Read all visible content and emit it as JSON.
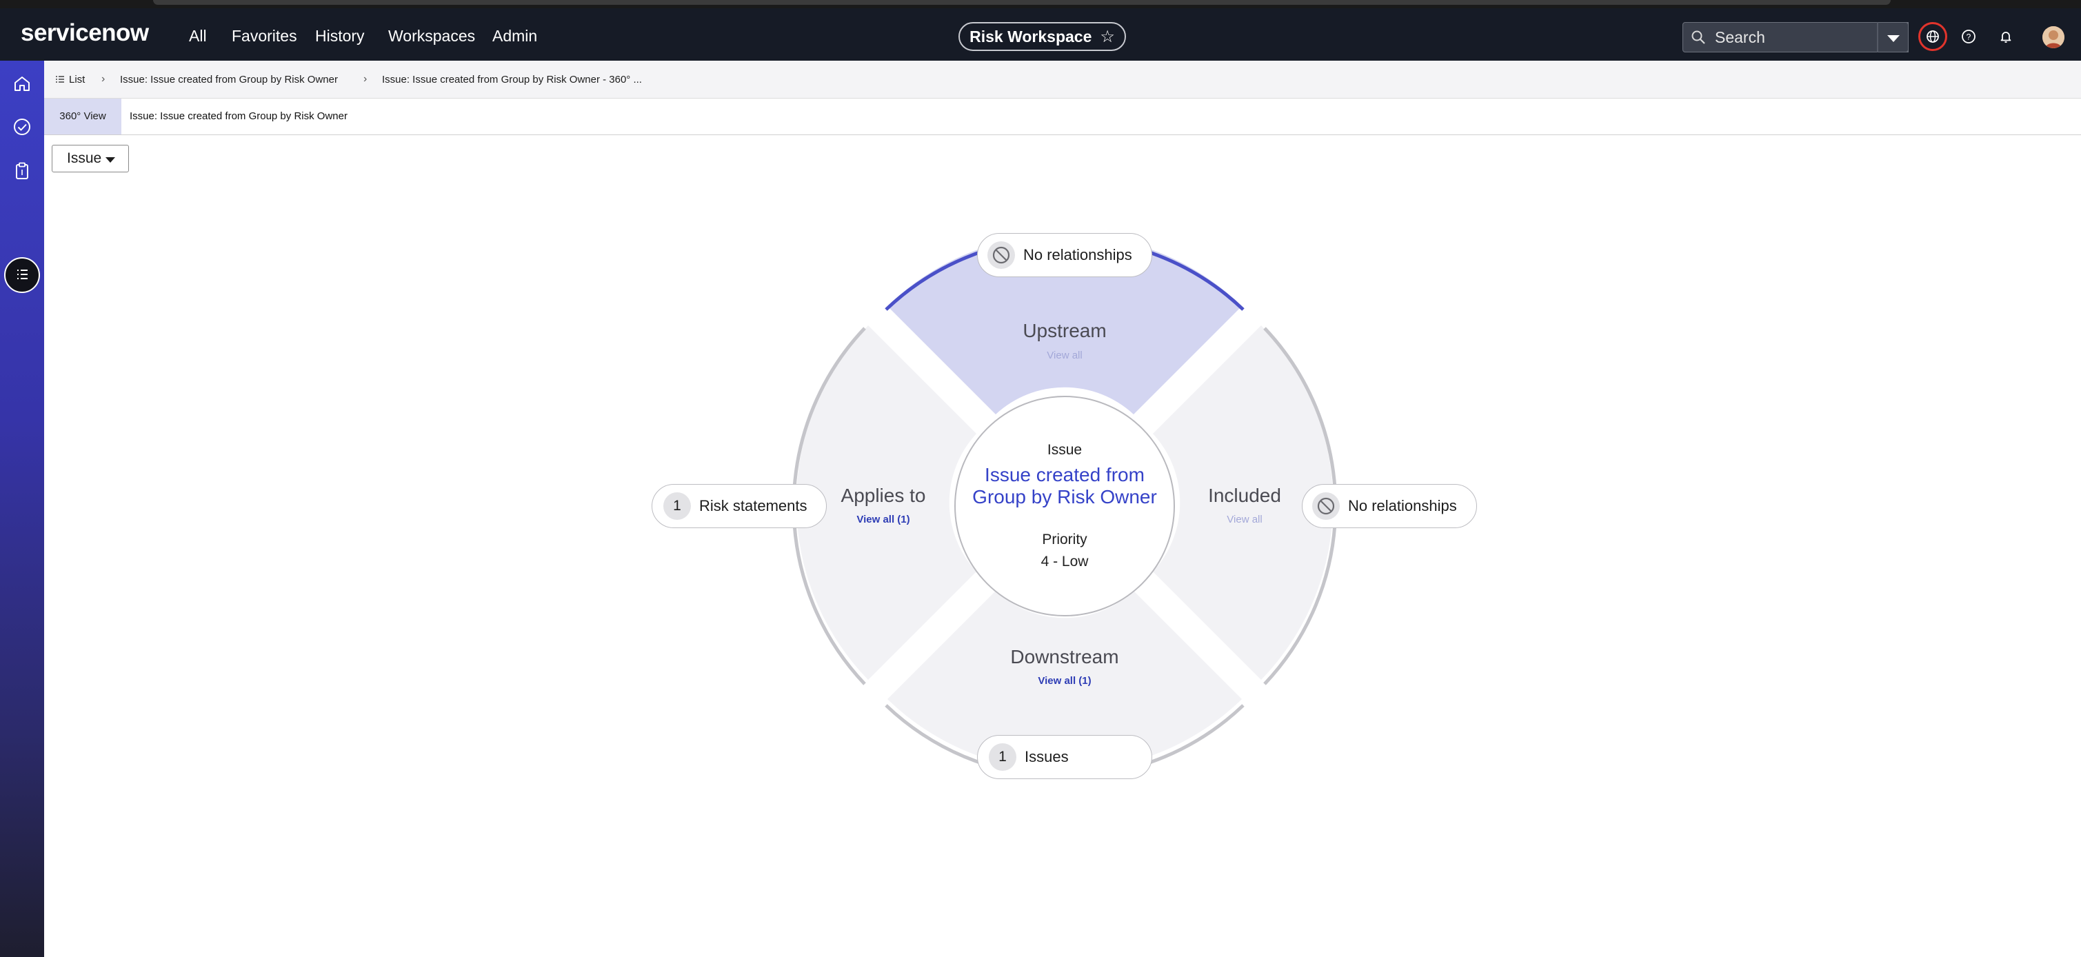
{
  "app": {
    "logo": "servicenow",
    "nav": [
      "All",
      "Favorites",
      "History",
      "Workspaces",
      "Admin"
    ],
    "workspace": "Risk Workspace",
    "search_placeholder": "Search"
  },
  "breadcrumb": {
    "list_label": "List",
    "items": [
      "Issue: Issue created from Group by Risk Owner",
      "Issue: Issue created from Group by Risk Owner - 360° ..."
    ]
  },
  "tabs": {
    "view_tab": "360° View",
    "record_title": "Issue: Issue created from Group by Risk Owner"
  },
  "filter": {
    "selected": "Issue"
  },
  "diagram": {
    "center": {
      "type": "Issue",
      "title_line1": "Issue created from",
      "title_line2": "Group by Risk Owner",
      "priority_label": "Priority",
      "priority_value": "4 - Low"
    },
    "quadrants": {
      "upstream": {
        "title": "Upstream",
        "view_all": "View all"
      },
      "applies_to": {
        "title": "Applies to",
        "view_all": "View all (1)"
      },
      "included": {
        "title": "Included",
        "view_all": "View all"
      },
      "downstream": {
        "title": "Downstream",
        "view_all": "View all (1)"
      }
    },
    "pills": {
      "top": {
        "label": "No relationships"
      },
      "left": {
        "count": "1",
        "label": "Risk statements"
      },
      "right": {
        "label": "No relationships"
      },
      "bottom": {
        "count": "1",
        "label": "Issues"
      }
    },
    "colors": {
      "selected_fill": "#d3d5f1",
      "quadrant_fill": "#f2f2f5",
      "selected_arc": "#4a50c8",
      "arc": "#c5c5ca",
      "link_active": "#2e3db5",
      "link_muted": "#a3a8d8"
    }
  }
}
